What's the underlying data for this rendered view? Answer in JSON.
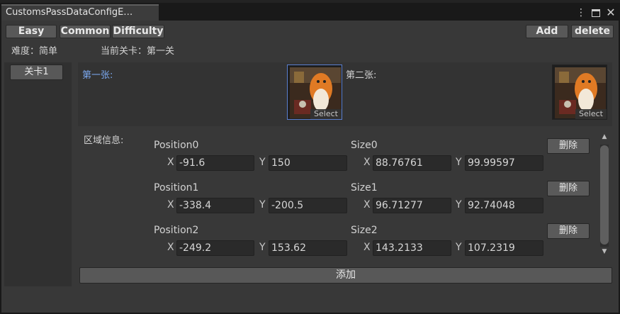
{
  "window": {
    "tab_title": "CustomsPassDataConfigE…",
    "icons": [
      "kebab-menu-icon",
      "maximize-icon",
      "close-icon"
    ]
  },
  "toolbar": {
    "easy_label": "Easy",
    "common_label": "Common",
    "difficulty_label": "Difficulty",
    "add_label": "Add",
    "delete_label": "delete"
  },
  "status": {
    "difficulty_text": "难度：简单",
    "current_level_text": "当前关卡：第一关"
  },
  "sidebar": {
    "levels": [
      {
        "label": "关卡1"
      }
    ]
  },
  "images": {
    "first_label": "第一张:",
    "second_label": "第二张:",
    "select_label": "Select"
  },
  "regions": {
    "label": "区域信息:",
    "delete_label": "删除",
    "x_label": "X",
    "y_label": "Y",
    "items": [
      {
        "position_label": "Position0",
        "pos_x": "-91.6",
        "pos_y": "150",
        "size_label": "Size0",
        "size_x": "88.76761",
        "size_y": "99.99597"
      },
      {
        "position_label": "Position1",
        "pos_x": "-338.4",
        "pos_y": "-200.5",
        "size_label": "Size1",
        "size_x": "96.71277",
        "size_y": "92.74048"
      },
      {
        "position_label": "Position2",
        "pos_x": "-249.2",
        "pos_y": "153.62",
        "size_label": "Size2",
        "size_x": "143.2133",
        "size_y": "107.2319"
      }
    ]
  },
  "footer": {
    "add_label": "添加"
  },
  "colors": {
    "accent_blue": "#7aa7ee",
    "selected_border": "#5a7fd0",
    "background": "#383838"
  }
}
